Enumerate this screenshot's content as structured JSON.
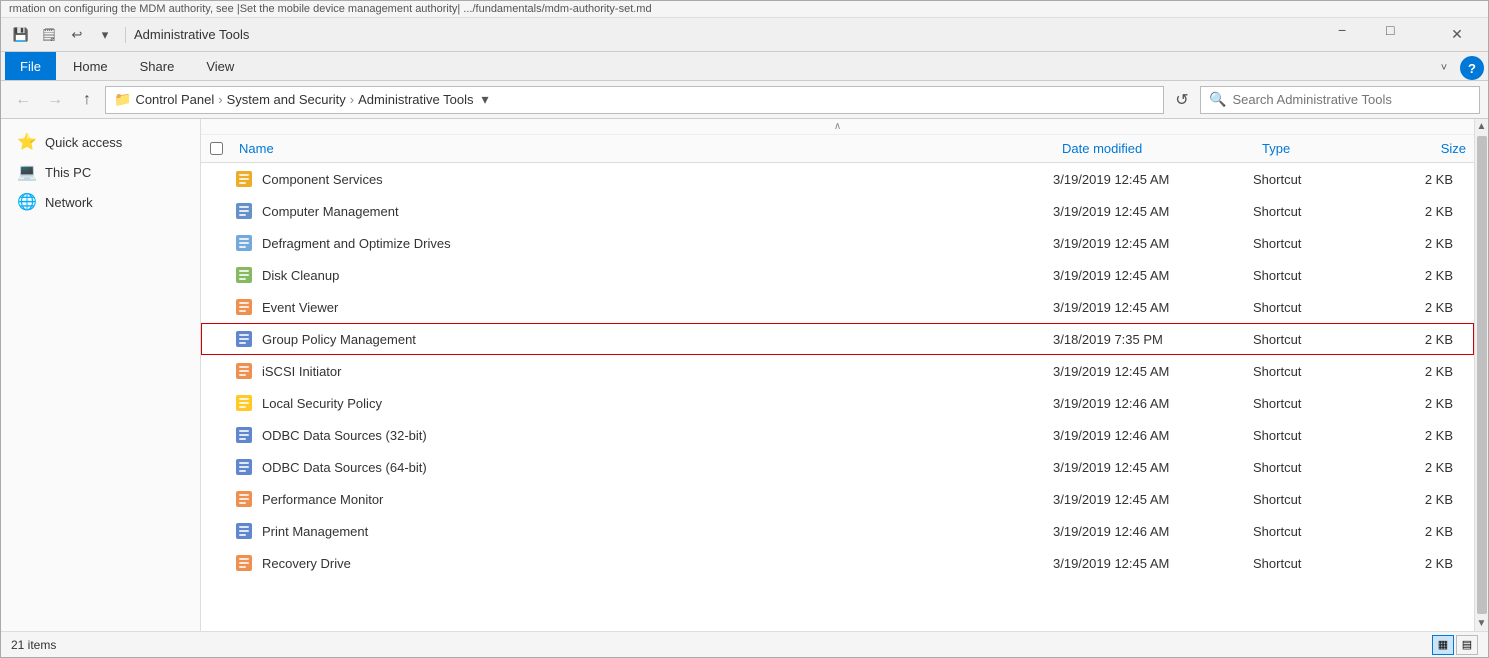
{
  "topStrip": {
    "text": "rmation on configuring the MDM authority, see |Set the mobile device management authority| .../fundamentals/mdm-authority-set.md"
  },
  "titleBar": {
    "title": "Administrative Tools",
    "minimizeLabel": "−",
    "maximizeLabel": "□",
    "closeLabel": "✕"
  },
  "quickAccess": {
    "saveIcon": "💾",
    "undoIcon": "↩",
    "dropdownIcon": "▾"
  },
  "ribbon": {
    "tabs": [
      {
        "label": "File",
        "active": true
      },
      {
        "label": "Home",
        "active": false
      },
      {
        "label": "Share",
        "active": false
      },
      {
        "label": "View",
        "active": false
      }
    ],
    "expandIcon": "˅",
    "helpIcon": "?"
  },
  "addressBar": {
    "backIcon": "←",
    "forwardIcon": "→",
    "upIcon": "↑",
    "folderIcon": "📁",
    "breadcrumb": [
      {
        "label": "Control Panel"
      },
      {
        "label": "System and Security"
      },
      {
        "label": "Administrative Tools"
      }
    ],
    "dropdownIcon": "▾",
    "refreshIcon": "↺",
    "searchPlaceholder": "Search Administrative Tools",
    "searchIcon": "🔍"
  },
  "sidebar": {
    "items": [
      {
        "label": "Quick access",
        "icon": "⭐",
        "selected": false
      },
      {
        "label": "This PC",
        "icon": "💻",
        "selected": false
      },
      {
        "label": "Network",
        "icon": "🌐",
        "selected": false
      }
    ]
  },
  "fileList": {
    "columns": {
      "name": "Name",
      "dateModified": "Date modified",
      "type": "Type",
      "size": "Size"
    },
    "sortArrow": "∧",
    "items": [
      {
        "name": "Component Services",
        "date": "3/19/2019 12:45 AM",
        "type": "Shortcut",
        "size": "2 KB",
        "iconClass": "icon-component",
        "iconChar": "⚙",
        "highlighted": false
      },
      {
        "name": "Computer Management",
        "date": "3/19/2019 12:45 AM",
        "type": "Shortcut",
        "size": "2 KB",
        "iconClass": "icon-computer",
        "iconChar": "🖥",
        "highlighted": false
      },
      {
        "name": "Defragment and Optimize Drives",
        "date": "3/19/2019 12:45 AM",
        "type": "Shortcut",
        "size": "2 KB",
        "iconClass": "icon-defrag",
        "iconChar": "💽",
        "highlighted": false
      },
      {
        "name": "Disk Cleanup",
        "date": "3/19/2019 12:45 AM",
        "type": "Shortcut",
        "size": "2 KB",
        "iconClass": "icon-disk",
        "iconChar": "🗑",
        "highlighted": false
      },
      {
        "name": "Event Viewer",
        "date": "3/19/2019 12:45 AM",
        "type": "Shortcut",
        "size": "2 KB",
        "iconClass": "icon-event",
        "iconChar": "📋",
        "highlighted": false
      },
      {
        "name": "Group Policy Management",
        "date": "3/18/2019 7:35 PM",
        "type": "Shortcut",
        "size": "2 KB",
        "iconClass": "icon-group",
        "iconChar": "📄",
        "highlighted": true
      },
      {
        "name": "iSCSI Initiator",
        "date": "3/19/2019 12:45 AM",
        "type": "Shortcut",
        "size": "2 KB",
        "iconClass": "icon-iscsi",
        "iconChar": "📄",
        "highlighted": false
      },
      {
        "name": "Local Security Policy",
        "date": "3/19/2019 12:46 AM",
        "type": "Shortcut",
        "size": "2 KB",
        "iconClass": "icon-security",
        "iconChar": "🔒",
        "highlighted": false
      },
      {
        "name": "ODBC Data Sources (32-bit)",
        "date": "3/19/2019 12:46 AM",
        "type": "Shortcut",
        "size": "2 KB",
        "iconClass": "icon-odbc",
        "iconChar": "📄",
        "highlighted": false
      },
      {
        "name": "ODBC Data Sources (64-bit)",
        "date": "3/19/2019 12:45 AM",
        "type": "Shortcut",
        "size": "2 KB",
        "iconClass": "icon-odbc",
        "iconChar": "📄",
        "highlighted": false
      },
      {
        "name": "Performance Monitor",
        "date": "3/19/2019 12:45 AM",
        "type": "Shortcut",
        "size": "2 KB",
        "iconClass": "icon-perf",
        "iconChar": "📊",
        "highlighted": false
      },
      {
        "name": "Print Management",
        "date": "3/19/2019 12:46 AM",
        "type": "Shortcut",
        "size": "2 KB",
        "iconClass": "icon-print",
        "iconChar": "🖨",
        "highlighted": false
      },
      {
        "name": "Recovery Drive",
        "date": "3/19/2019 12:45 AM",
        "type": "Shortcut",
        "size": "2 KB",
        "iconClass": "icon-recovery",
        "iconChar": "💿",
        "highlighted": false
      }
    ]
  },
  "statusBar": {
    "itemCount": "21 items",
    "detailsIcon": "▦",
    "listIcon": "▤"
  }
}
